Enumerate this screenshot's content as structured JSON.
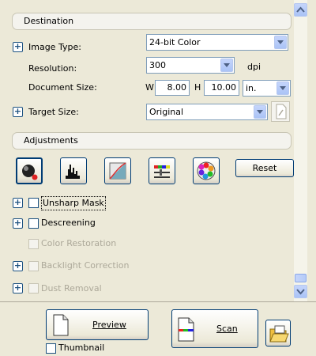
{
  "destination": {
    "header": "Destination",
    "image_type": {
      "label": "Image Type:",
      "value": "24-bit Color"
    },
    "resolution": {
      "label": "Resolution:",
      "value": "300",
      "unit": "dpi"
    },
    "document_size": {
      "label": "Document Size:",
      "w_label": "W",
      "w_value": "8.00",
      "h_label": "H",
      "h_value": "10.00",
      "unit": "in."
    },
    "target_size": {
      "label": "Target Size:",
      "value": "Original"
    }
  },
  "adjustments": {
    "header": "Adjustments",
    "icons": [
      "auto-exposure-icon",
      "histogram-icon",
      "tone-curve-icon",
      "image-adjustment-icon",
      "color-palette-icon"
    ],
    "reset_label": "Reset",
    "options": [
      {
        "label": "Unsharp Mask",
        "enabled": true,
        "checked": false,
        "expandable": true
      },
      {
        "label": "Descreening",
        "enabled": true,
        "checked": false,
        "expandable": true
      },
      {
        "label": "Color Restoration",
        "enabled": false,
        "checked": false,
        "expandable": false
      },
      {
        "label": "Backlight Correction",
        "enabled": false,
        "checked": false,
        "expandable": true
      },
      {
        "label": "Dust Removal",
        "enabled": false,
        "checked": false,
        "expandable": true
      }
    ]
  },
  "footer": {
    "preview_label": "Preview",
    "scan_label": "Scan",
    "thumbnail_label": "Thumbnail"
  },
  "colors": {
    "window_bg": "#ece9d8",
    "accent": "#003c74"
  }
}
